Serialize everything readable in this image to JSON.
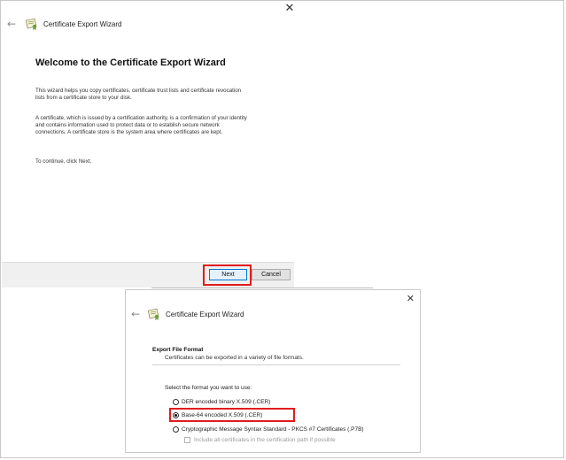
{
  "wizard_top": {
    "close_glyph": "✕",
    "back_icon": "back-arrow-icon",
    "title": "Certificate Export Wizard",
    "heading": "Welcome to the Certificate Export Wizard",
    "paragraph1": "This wizard helps you copy certificates, certificate trust lists and certificate revocation\nlists from a certificate store to your disk.",
    "paragraph2": "A certificate, which is issued by a certification authority, is a confirmation of your identity\nand contains information used to protect data or to establish secure network\nconnections. A certificate store is the system area where certificates are kept.",
    "paragraph3": "To continue, click Next.",
    "next_label": "Next",
    "cancel_label": "Cancel"
  },
  "wizard_bottom": {
    "close_glyph": "✕",
    "back_icon": "back-arrow-icon",
    "title": "Certificate Export Wizard",
    "section_title": "Export File Format",
    "section_subtitle": "Certificates can be exported in a variety of file formats.",
    "prompt": "Select the format you want to use:",
    "options": [
      {
        "label": "DER encoded binary X.509 (.CER)",
        "selected": false
      },
      {
        "label": "Base-64 encoded X.509 (.CER)",
        "selected": true
      },
      {
        "label": "Cryptographic Message Syntax Standard - PKCS #7 Certificates (.P7B)",
        "selected": false
      }
    ],
    "include_all_label": "Include all certificates in the certification path if possible"
  },
  "colors": {
    "highlight": "#e01c1c",
    "primary_button_border": "#0078d7"
  }
}
